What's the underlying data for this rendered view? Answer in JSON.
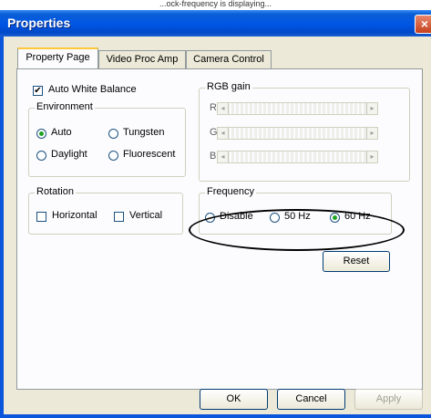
{
  "top_caption": "...ock-frequency is displaying... ",
  "window": {
    "title": "Properties",
    "close_glyph": "×"
  },
  "tabs": [
    {
      "label": "Property Page",
      "active": true
    },
    {
      "label": "Video Proc Amp",
      "active": false
    },
    {
      "label": "Camera Control",
      "active": false
    }
  ],
  "auto_white_balance": {
    "label": "Auto White Balance",
    "checked": true,
    "mark": "✔"
  },
  "environment": {
    "legend": "Environment",
    "options": [
      {
        "label": "Auto",
        "selected": true
      },
      {
        "label": "Tungsten",
        "selected": false
      },
      {
        "label": "Daylight",
        "selected": false
      },
      {
        "label": "Fluorescent",
        "selected": false
      }
    ]
  },
  "rgb_gain": {
    "legend": "RGB gain",
    "channels": [
      {
        "label": "R",
        "value": 0
      },
      {
        "label": "G",
        "value": 0
      },
      {
        "label": "B",
        "value": 0
      }
    ],
    "left_arrow": "◂",
    "right_arrow": "▸"
  },
  "rotation": {
    "legend": "Rotation",
    "options": [
      {
        "label": "Horizontal",
        "checked": false
      },
      {
        "label": "Vertical",
        "checked": false
      }
    ]
  },
  "frequency": {
    "legend": "Frequency",
    "options": [
      {
        "label": "Disable",
        "selected": false
      },
      {
        "label": "50 Hz",
        "selected": false
      },
      {
        "label": "60 Hz",
        "selected": true
      }
    ]
  },
  "reset_button": "Reset",
  "footer": {
    "ok": "OK",
    "cancel": "Cancel",
    "apply": "Apply"
  },
  "colors": {
    "title_bar": "#0055e5",
    "dialog_bg": "#ece9d8",
    "active_tab_accent": "#ffc83c",
    "close_button": "#c5401c"
  }
}
